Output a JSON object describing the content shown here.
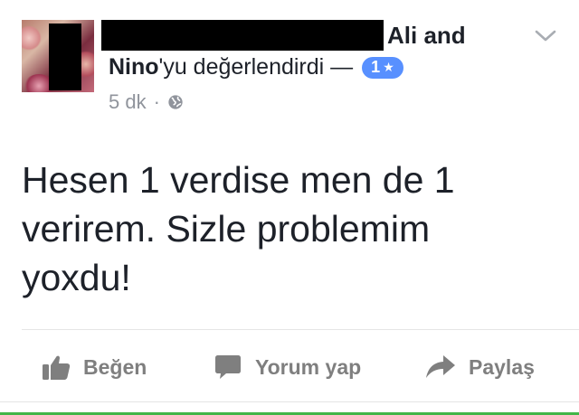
{
  "post": {
    "author_line1": "Ali and",
    "author_line2_bold": "Nino",
    "author_line2_rest": "'yu değerlendirdi —",
    "rating": {
      "value": "1",
      "icon": "star-icon",
      "color": "#5890ff"
    },
    "timestamp": "5 dk",
    "separator": "·",
    "privacy_icon": "globe-icon",
    "menu_icon": "chevron-down-icon",
    "text": "Hesen 1 verdise men de 1 verirem. Sizle problemim yoxdu!"
  },
  "actions": {
    "like": {
      "label": "Beğen",
      "icon": "thumbs-up-icon"
    },
    "comment": {
      "label": "Yorum yap",
      "icon": "comment-bubble-icon"
    },
    "share": {
      "label": "Paylaş",
      "icon": "share-arrow-icon"
    }
  },
  "colors": {
    "text": "#1d2129",
    "meta": "#90949c",
    "action": "#7f7f7f",
    "accent_green": "#41b548"
  }
}
